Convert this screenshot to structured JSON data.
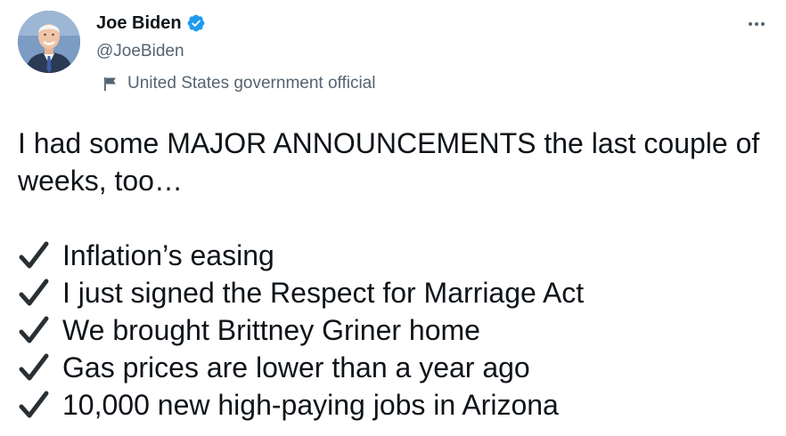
{
  "author": {
    "display_name": "Joe Biden",
    "handle": "@JoeBiden",
    "verified": true,
    "account_label": "United States government official",
    "avatar_icon": "avatar-photo",
    "verified_icon": "verified-badge-icon",
    "label_icon": "flag-icon"
  },
  "tweet": {
    "intro": "I had some MAJOR ANNOUNCEMENTS the last couple of weeks, too…",
    "items": [
      {
        "icon": "check-mark-icon",
        "text": "Inflation’s easing"
      },
      {
        "icon": "check-mark-icon",
        "text": "I just signed the Respect for Marriage Act"
      },
      {
        "icon": "check-mark-icon",
        "text": "We brought Brittney Griner home"
      },
      {
        "icon": "check-mark-icon",
        "text": "Gas prices are lower than a year ago"
      },
      {
        "icon": "check-mark-icon",
        "text": "10,000 new high-paying jobs in Arizona"
      }
    ]
  },
  "more_menu": {
    "icon": "more-horizontal-icon"
  },
  "colors": {
    "text_primary": "#0f1419",
    "text_secondary": "#536471",
    "verified_blue": "#1d9bf0"
  }
}
